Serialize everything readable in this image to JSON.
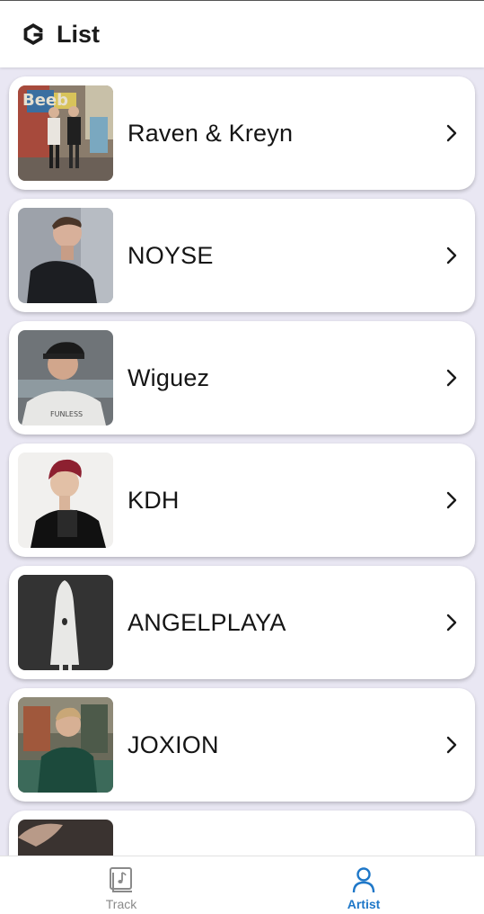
{
  "header": {
    "title": "List",
    "logo_icon": "g-logo-icon"
  },
  "artists": [
    {
      "name": "Raven & Kreyn"
    },
    {
      "name": "NOYSE"
    },
    {
      "name": "Wiguez"
    },
    {
      "name": "KDH"
    },
    {
      "name": "ANGELPLAYA"
    },
    {
      "name": "JOXION"
    },
    {
      "name": ""
    }
  ],
  "nav": {
    "track_label": "Track",
    "artist_label": "Artist",
    "active_color": "#1e77c8",
    "inactive_color": "#8a8a8a"
  }
}
